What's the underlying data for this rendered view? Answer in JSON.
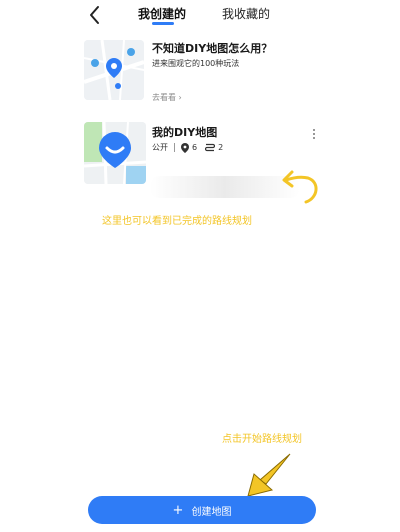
{
  "header": {
    "tabs": [
      {
        "label": "我创建的",
        "active": true
      },
      {
        "label": "我收藏的",
        "active": false
      }
    ],
    "accent_color": "#2f7cf6"
  },
  "guide_card": {
    "title": "不知道DIY地图怎么用？",
    "subtitle": "进来围观它的100种玩法",
    "link_label": "去看看",
    "link_icon": "chevron-right-icon"
  },
  "my_map": {
    "title": "我的DIY地图",
    "visibility": "公开",
    "place_count": "6",
    "route_count": "2",
    "place_icon": "location-pin-icon",
    "route_icon": "route-icon",
    "more_icon": "more-vertical-icon"
  },
  "annotations": {
    "note_view_routes": "这里也可以看到已完成的路线规划",
    "note_start": "点击开始路线规划",
    "color": "#f3c526"
  },
  "bottom": {
    "create_label": "创建地图",
    "create_icon": "plus-icon"
  }
}
